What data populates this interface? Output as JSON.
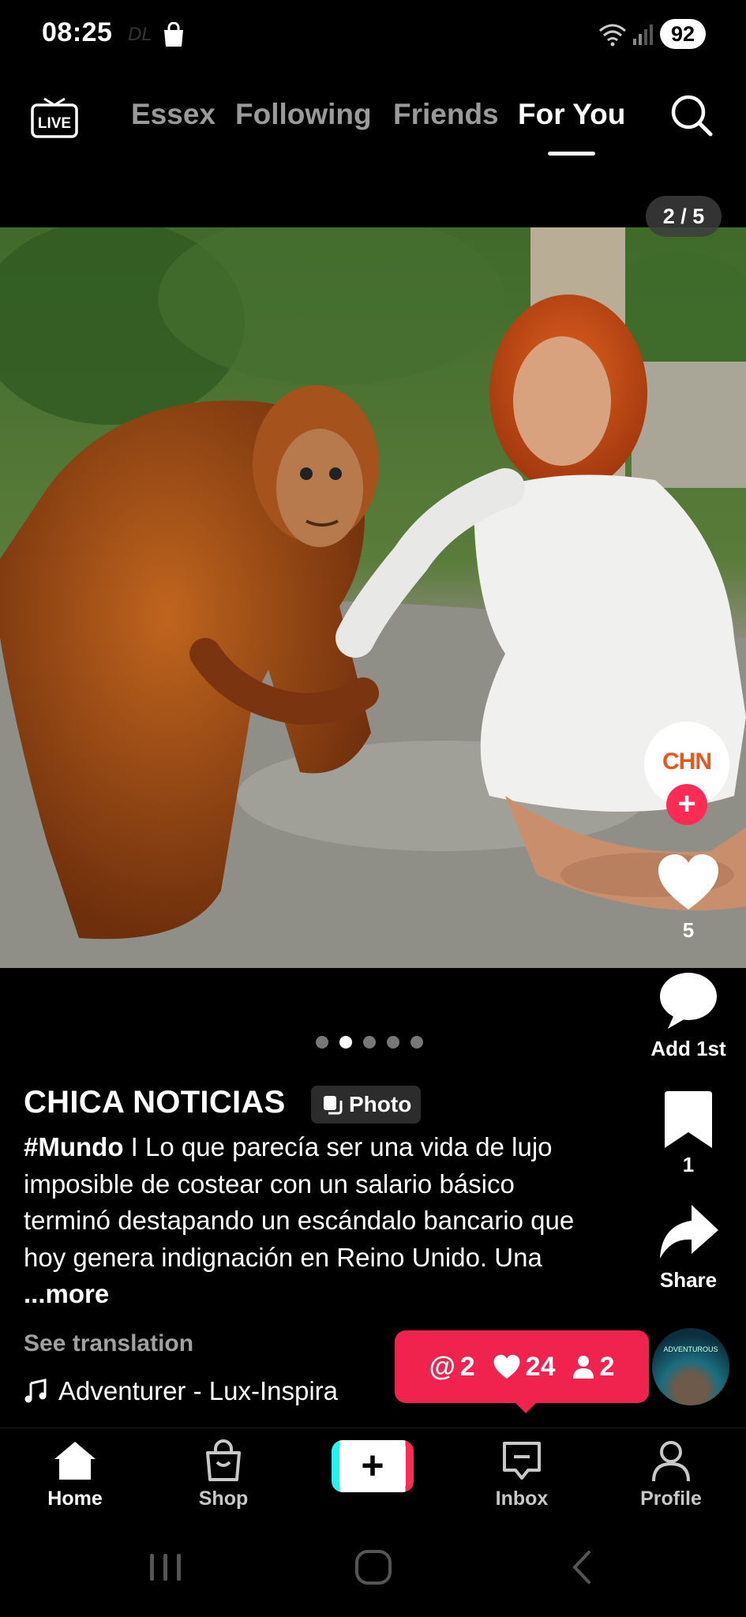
{
  "status": {
    "time": "08:25",
    "carrier_mark": "DL",
    "battery": "92"
  },
  "top_nav": {
    "tabs": [
      {
        "label": "Essex",
        "active": false
      },
      {
        "label": "Following",
        "active": false
      },
      {
        "label": "Friends",
        "active": false
      },
      {
        "label": "For You",
        "active": true
      }
    ],
    "live_label": "LIVE"
  },
  "post": {
    "photo_counter": "2 / 5",
    "photo_count": 5,
    "current_photo": 2,
    "author": "CHICA NOTICIAS",
    "badge": "Photo",
    "caption_tag": "#Mundo",
    "caption_text": " I Lo que parecía ser una vida de lujo imposible de costear con un salario básico terminó destapando un escándalo bancario que hoy genera indignación en Reino Unido. Una ",
    "more_label": "...more",
    "see_translation": "See translation",
    "music": "Adventurer - Lux-Inspira"
  },
  "rail": {
    "avatar_text": "CHN",
    "likes": "5",
    "comments": "Add 1st",
    "bookmarks": "1",
    "share": "Share"
  },
  "notification": {
    "mentions": "2",
    "likes": "24",
    "followers": "2"
  },
  "disc": {
    "text": "ADVENTUROUS"
  },
  "bottom_nav": {
    "home": "Home",
    "shop": "Shop",
    "inbox": "Inbox",
    "profile": "Profile"
  },
  "colors": {
    "accent": "#fe2c55",
    "notif": "#f0224e",
    "cyan": "#25f4ee"
  }
}
